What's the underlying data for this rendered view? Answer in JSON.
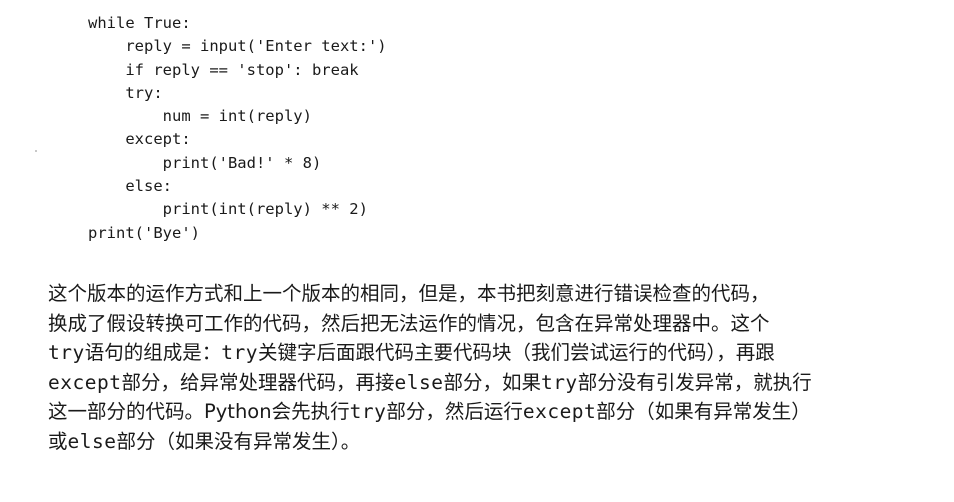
{
  "code": {
    "lines": [
      "while True:",
      "    reply = input('Enter text:')",
      "    if reply == 'stop': break",
      "    try:",
      "        num = int(reply)",
      "    except:",
      "        print('Bad!' * 8)",
      "    else:",
      "        print(int(reply) ** 2)",
      "print('Bye')"
    ]
  },
  "prose": {
    "l1": "这个版本的运作方式和上一个版本的相同，但是，本书把刻意进行错误检查的代码，",
    "l2": "换成了假设转换可工作的代码，然后把无法运作的情况，包含在异常处理器中。这个",
    "l3_kw1": "try",
    "l3_a": "语句的组成是：",
    "l3_kw2": "try",
    "l3_b": "关键字后面跟代码主要代码块（我们尝试运行的代码），再跟",
    "l4_kw1": "except",
    "l4_a": "部分，给异常处理器代码，再接",
    "l4_kw2": "else",
    "l4_b": "部分，如果",
    "l4_kw3": "try",
    "l4_c": "部分没有引发异常，就执行",
    "l5_a": "这一部分的代码。Python会先执行",
    "l5_kw1": "try",
    "l5_b": "部分，然后运行",
    "l5_kw2": "except",
    "l5_c": "部分（如果有异常发生）",
    "l6_a": "或",
    "l6_kw1": "else",
    "l6_b": "部分（如果没有异常发生）。"
  }
}
